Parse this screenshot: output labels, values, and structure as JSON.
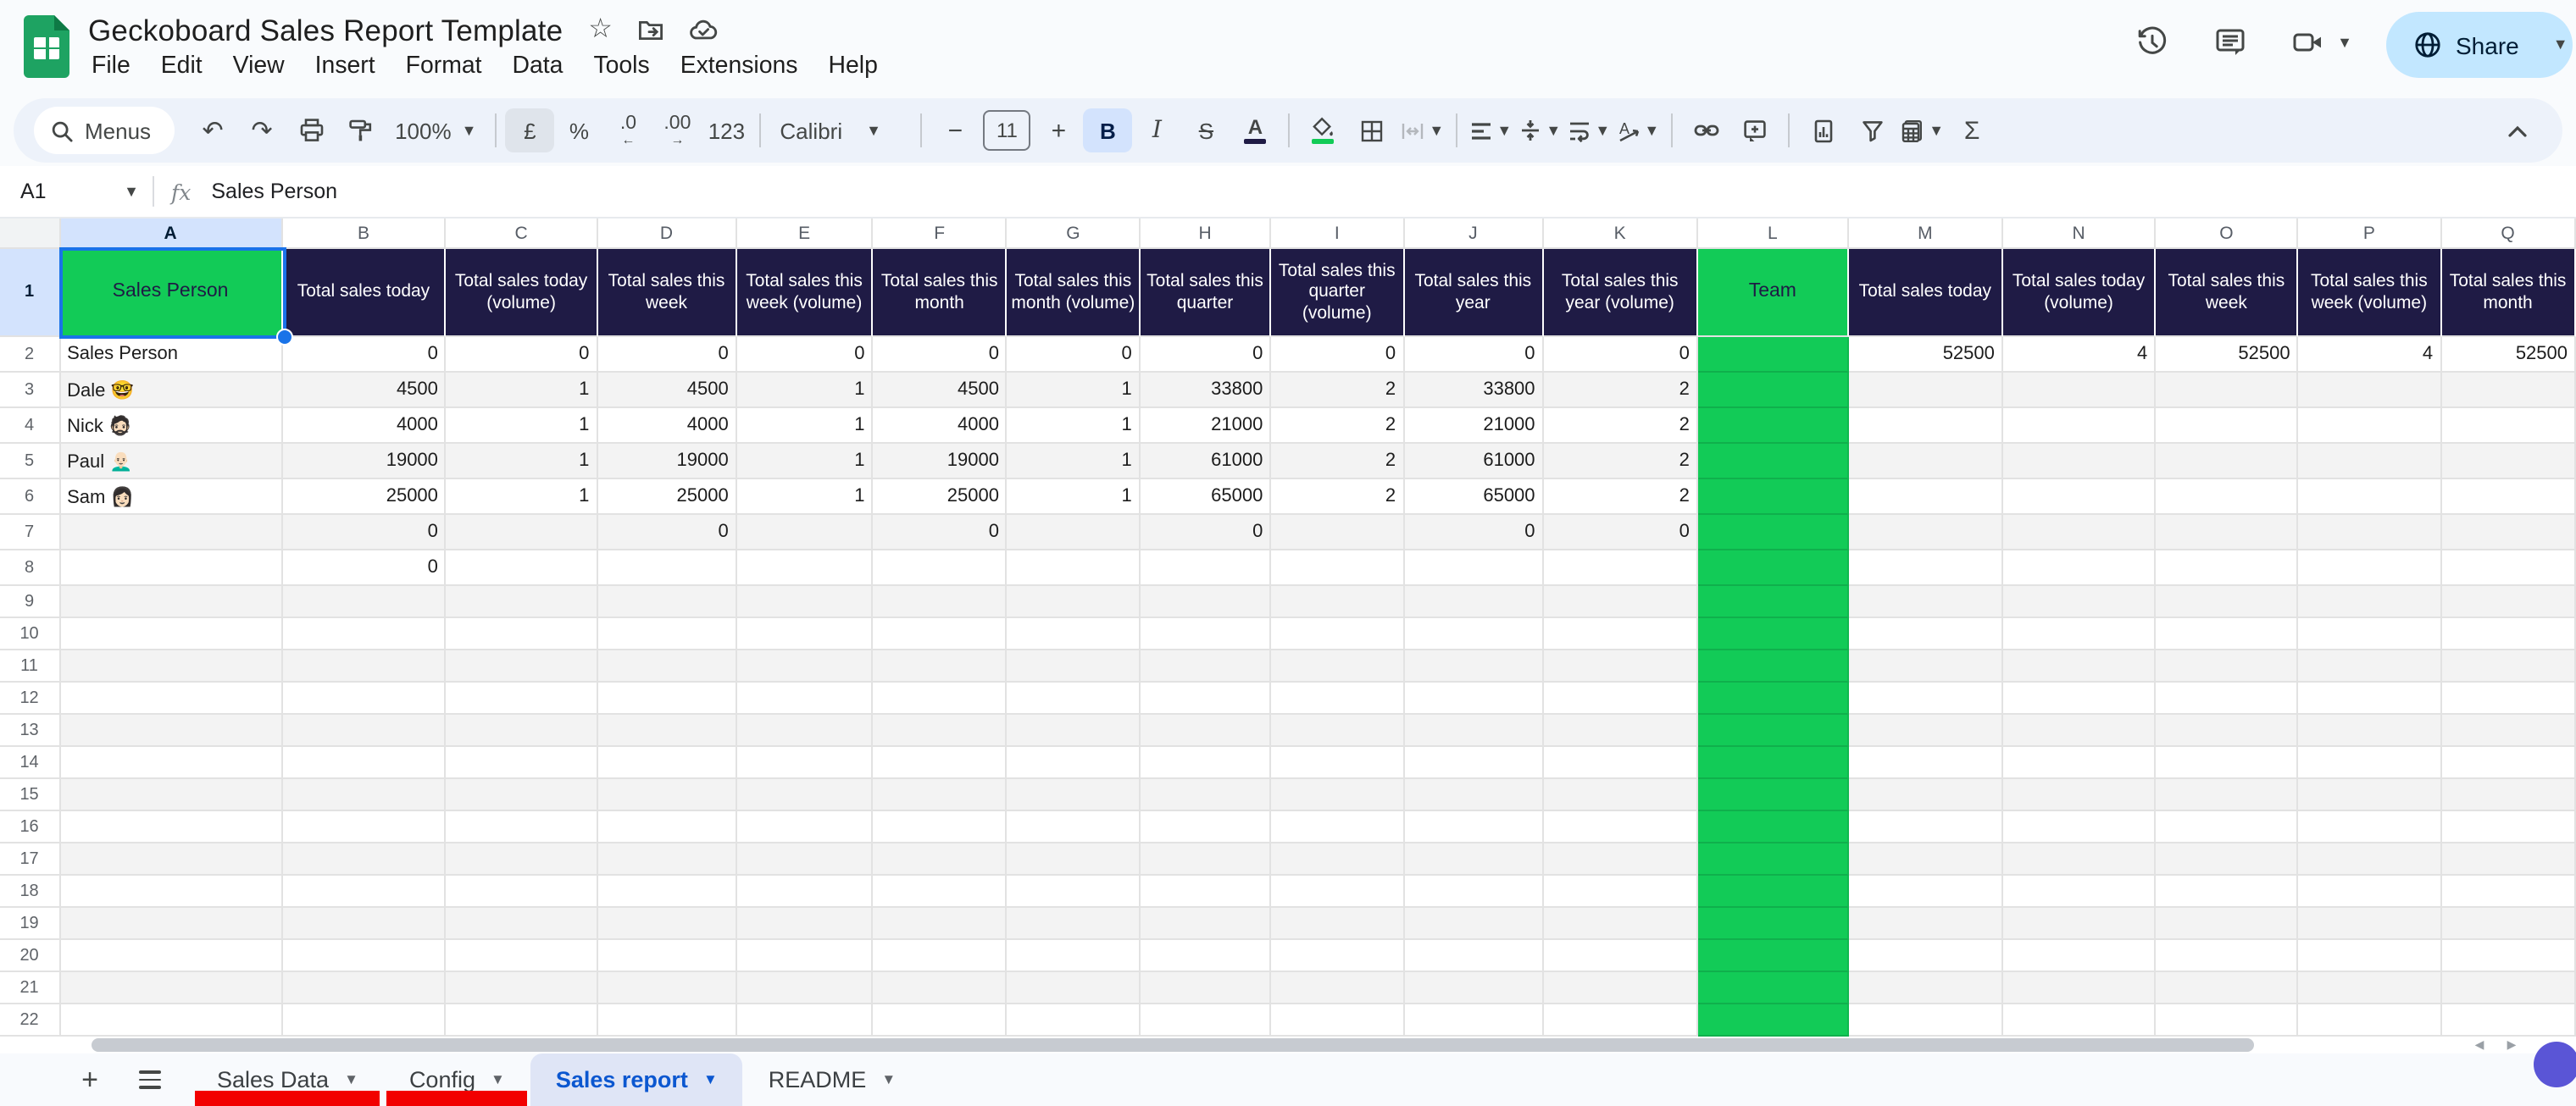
{
  "titlebar": {
    "title": "Geckoboard Sales Report Template",
    "menus": [
      "File",
      "Edit",
      "View",
      "Insert",
      "Format",
      "Data",
      "Tools",
      "Extensions",
      "Help"
    ],
    "share_label": "Share",
    "star_glyph": "☆"
  },
  "toolbar": {
    "search_label": "Menus",
    "zoom_value": "100%",
    "currency": "£",
    "percent": "%",
    "decrease_decimal": ".0",
    "increase_decimal": ".00",
    "more_formats": "123",
    "font_name": "Calibri",
    "font_size": "11",
    "minus": "−",
    "plus": "+",
    "bold": "B",
    "italic": "I",
    "strikethrough": "S",
    "text_color": "A",
    "functions": "Σ",
    "undo_glyph": "↶",
    "redo_glyph": "↷"
  },
  "formula_bar": {
    "cell_ref": "A1",
    "fx": "fx",
    "content": "Sales Person"
  },
  "grid": {
    "visible_rows": 22,
    "selected_cell": "A1",
    "columns": [
      {
        "letter": "A",
        "header": "Sales Person",
        "accent": "green"
      },
      {
        "letter": "B",
        "header": "Total sales today",
        "accent": "navy"
      },
      {
        "letter": "C",
        "header": "Total sales today (volume)",
        "accent": "navy"
      },
      {
        "letter": "D",
        "header": "Total sales this week",
        "accent": "navy"
      },
      {
        "letter": "E",
        "header": "Total sales this week (volume)",
        "accent": "navy"
      },
      {
        "letter": "F",
        "header": "Total sales this month",
        "accent": "navy"
      },
      {
        "letter": "G",
        "header": "Total sales this month (volume)",
        "accent": "navy"
      },
      {
        "letter": "H",
        "header": "Total sales this quarter",
        "accent": "navy"
      },
      {
        "letter": "I",
        "header": "Total sales this quarter (volume)",
        "accent": "navy"
      },
      {
        "letter": "J",
        "header": "Total sales this year",
        "accent": "navy"
      },
      {
        "letter": "K",
        "header": "Total sales this year (volume)",
        "accent": "navy"
      },
      {
        "letter": "L",
        "header": "Team",
        "accent": "green",
        "fill_column": true
      },
      {
        "letter": "M",
        "header": "Total sales today",
        "accent": "navy"
      },
      {
        "letter": "N",
        "header": "Total sales today (volume)",
        "accent": "navy"
      },
      {
        "letter": "O",
        "header": "Total sales this week",
        "accent": "navy"
      },
      {
        "letter": "P",
        "header": "Total sales this week (volume)",
        "accent": "navy"
      },
      {
        "letter": "Q",
        "header": "Total sales this month",
        "accent": "navy"
      }
    ],
    "cells": {
      "2": {
        "A": "Sales Person",
        "B": "0",
        "C": "0",
        "D": "0",
        "E": "0",
        "F": "0",
        "G": "0",
        "H": "0",
        "I": "0",
        "J": "0",
        "K": "0",
        "M": "52500",
        "N": "4",
        "O": "52500",
        "P": "4",
        "Q": "52500"
      },
      "3": {
        "A": "Dale 🤓",
        "B": "4500",
        "C": "1",
        "D": "4500",
        "E": "1",
        "F": "4500",
        "G": "1",
        "H": "33800",
        "I": "2",
        "J": "33800",
        "K": "2"
      },
      "4": {
        "A": "Nick 🧔🏻",
        "B": "4000",
        "C": "1",
        "D": "4000",
        "E": "1",
        "F": "4000",
        "G": "1",
        "H": "21000",
        "I": "2",
        "J": "21000",
        "K": "2"
      },
      "5": {
        "A": "Paul 👨🏻‍🦲",
        "B": "19000",
        "C": "1",
        "D": "19000",
        "E": "1",
        "F": "19000",
        "G": "1",
        "H": "61000",
        "I": "2",
        "J": "61000",
        "K": "2"
      },
      "6": {
        "A": "Sam 👩🏻",
        "B": "25000",
        "C": "1",
        "D": "25000",
        "E": "1",
        "F": "25000",
        "G": "1",
        "H": "65000",
        "I": "2",
        "J": "65000",
        "K": "2"
      },
      "7": {
        "B": "0",
        "D": "0",
        "F": "0",
        "H": "0",
        "J": "0",
        "K": "0"
      },
      "8": {
        "B": "0"
      }
    }
  },
  "sheet_tabs": {
    "add_glyph": "+",
    "tabs": [
      {
        "label": "Sales Data",
        "color_bar": true
      },
      {
        "label": "Config",
        "color_bar": true
      },
      {
        "label": "Sales report",
        "active": true
      },
      {
        "label": "README"
      }
    ]
  },
  "colors": {
    "header_navy": "#1f1b45",
    "accent_green": "#12cb57",
    "selection_blue": "#1a73e8",
    "selected_header_bg": "#d3e3fd",
    "band_grey": "#f3f3f3",
    "tab_red": "#f20000",
    "active_tab_blue": "#0b57d0",
    "share_bg": "#c2e7ff",
    "toolbar_bg": "#edf2fa",
    "fab_purple": "#5a55d6"
  }
}
